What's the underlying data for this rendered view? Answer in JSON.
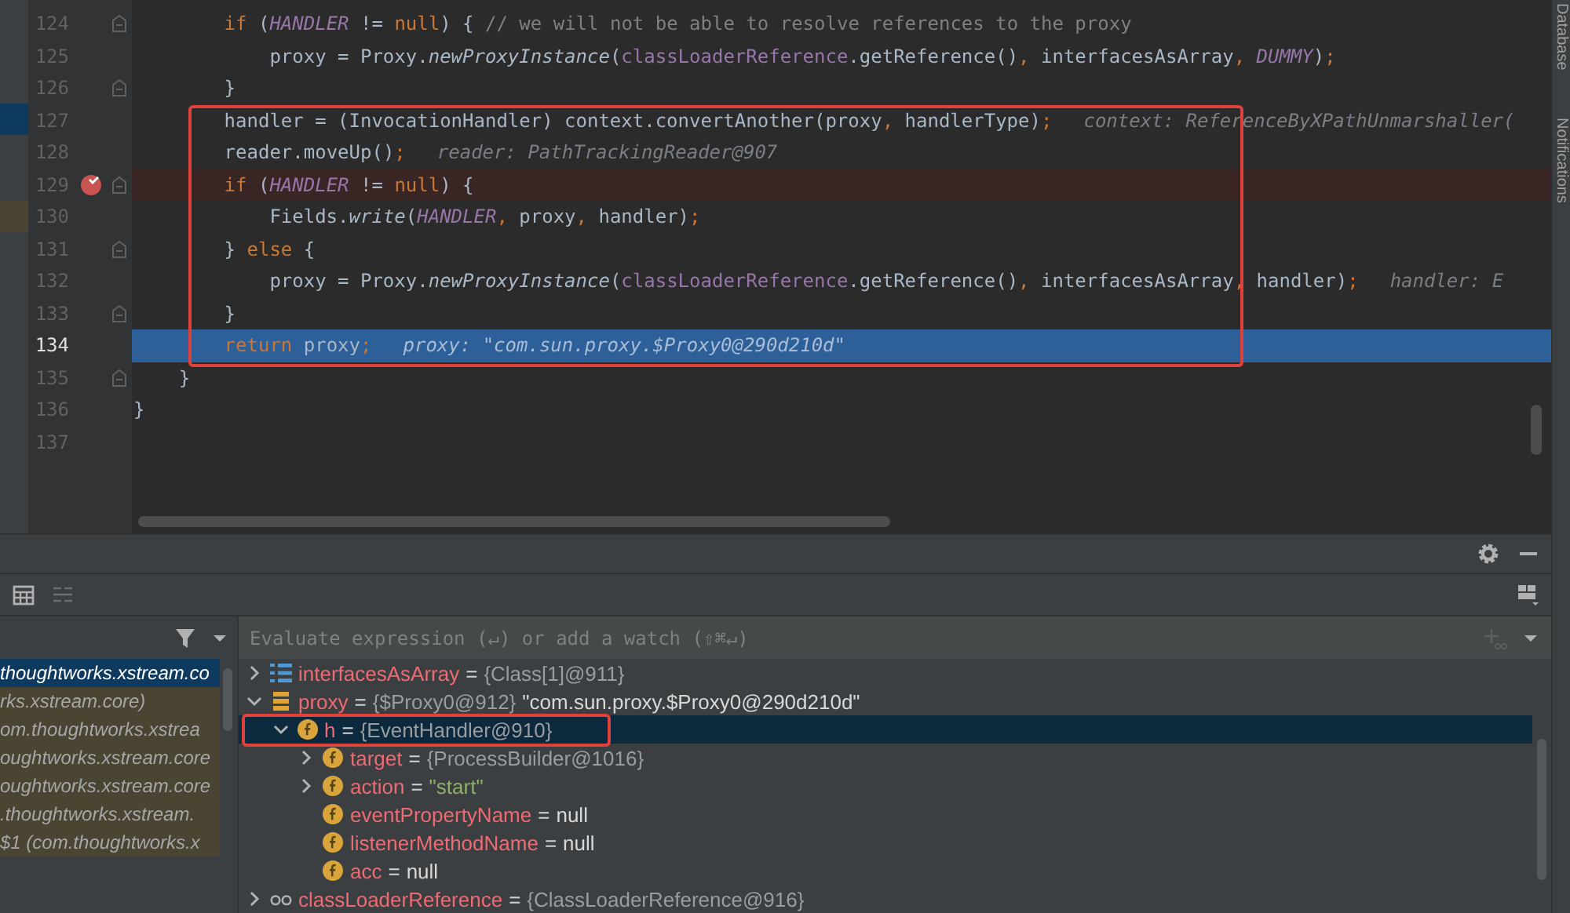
{
  "editor": {
    "lines": [
      {
        "number": "124",
        "fold": true,
        "breakpoint": false,
        "current": false,
        "boxed": false,
        "tokens": [
          {
            "kind": "kw",
            "text": "if"
          },
          {
            "kind": "plain",
            "text": " ("
          },
          {
            "kind": "static",
            "text": "HANDLER"
          },
          {
            "kind": "plain",
            "text": " != "
          },
          {
            "kind": "kw",
            "text": "null"
          },
          {
            "kind": "plain",
            "text": ") { "
          },
          {
            "kind": "comment",
            "text": "// we will not be able to resolve references to the proxy"
          }
        ]
      },
      {
        "number": "125",
        "fold": false,
        "breakpoint": false,
        "current": false,
        "boxed": false,
        "tokens": [
          {
            "kind": "plain",
            "text": "proxy = Proxy."
          },
          {
            "kind": "method",
            "text": "newProxyInstance"
          },
          {
            "kind": "plain",
            "text": "("
          },
          {
            "kind": "field",
            "text": "classLoaderReference"
          },
          {
            "kind": "plain",
            "text": ".getReference()"
          },
          {
            "kind": "punct",
            "text": ", "
          },
          {
            "kind": "plain",
            "text": "interfacesAsArray"
          },
          {
            "kind": "punct",
            "text": ", "
          },
          {
            "kind": "static",
            "text": "DUMMY"
          },
          {
            "kind": "plain",
            "text": ")"
          },
          {
            "kind": "punct",
            "text": ";"
          }
        ]
      },
      {
        "number": "126",
        "fold": true,
        "breakpoint": false,
        "current": false,
        "boxed": false,
        "tokens": [
          {
            "kind": "plain",
            "text": "}"
          }
        ]
      },
      {
        "number": "127",
        "fold": false,
        "breakpoint": false,
        "current": false,
        "boxed": true,
        "tokens": [
          {
            "kind": "plain",
            "text": "handler = (InvocationHandler) context.convertAnother(proxy"
          },
          {
            "kind": "punct",
            "text": ", "
          },
          {
            "kind": "plain",
            "text": "handlerType)"
          },
          {
            "kind": "punct",
            "text": ";"
          }
        ],
        "hint": "context: ReferenceByXPathUnmarshaller("
      },
      {
        "number": "128",
        "fold": false,
        "breakpoint": false,
        "current": false,
        "boxed": true,
        "tokens": [
          {
            "kind": "plain",
            "text": "reader.moveUp()"
          },
          {
            "kind": "punct",
            "text": ";"
          }
        ],
        "hint": "reader: PathTrackingReader@907"
      },
      {
        "number": "129",
        "fold": true,
        "breakpoint": true,
        "current": false,
        "boxed": true,
        "tokens": [
          {
            "kind": "kw",
            "text": "if"
          },
          {
            "kind": "plain",
            "text": " ("
          },
          {
            "kind": "static",
            "text": "HANDLER"
          },
          {
            "kind": "plain",
            "text": " != "
          },
          {
            "kind": "kw",
            "text": "null"
          },
          {
            "kind": "plain",
            "text": ") {"
          }
        ]
      },
      {
        "number": "130",
        "fold": false,
        "breakpoint": false,
        "current": false,
        "boxed": true,
        "tokens": [
          {
            "kind": "plain",
            "text": "Fields."
          },
          {
            "kind": "method",
            "text": "write"
          },
          {
            "kind": "plain",
            "text": "("
          },
          {
            "kind": "static",
            "text": "HANDLER"
          },
          {
            "kind": "punct",
            "text": ", "
          },
          {
            "kind": "plain",
            "text": "proxy"
          },
          {
            "kind": "punct",
            "text": ", "
          },
          {
            "kind": "plain",
            "text": "handler)"
          },
          {
            "kind": "punct",
            "text": ";"
          }
        ]
      },
      {
        "number": "131",
        "fold": true,
        "breakpoint": false,
        "current": false,
        "boxed": true,
        "tokens": [
          {
            "kind": "plain",
            "text": "} "
          },
          {
            "kind": "kw",
            "text": "else"
          },
          {
            "kind": "plain",
            "text": " {"
          }
        ]
      },
      {
        "number": "132",
        "fold": false,
        "breakpoint": false,
        "current": false,
        "boxed": true,
        "tokens": [
          {
            "kind": "plain",
            "text": "proxy = Proxy."
          },
          {
            "kind": "method",
            "text": "newProxyInstance"
          },
          {
            "kind": "plain",
            "text": "("
          },
          {
            "kind": "field",
            "text": "classLoaderReference"
          },
          {
            "kind": "plain",
            "text": ".getReference()"
          },
          {
            "kind": "punct",
            "text": ", "
          },
          {
            "kind": "plain",
            "text": "interfacesAsArray"
          },
          {
            "kind": "punct",
            "text": ", "
          },
          {
            "kind": "plain",
            "text": "handler)"
          },
          {
            "kind": "punct",
            "text": ";"
          }
        ],
        "hint": "handler: E"
      },
      {
        "number": "133",
        "fold": true,
        "breakpoint": false,
        "current": false,
        "boxed": true,
        "tokens": [
          {
            "kind": "plain",
            "text": "}"
          }
        ]
      },
      {
        "number": "134",
        "fold": false,
        "breakpoint": false,
        "current": true,
        "boxed": true,
        "tokens": [
          {
            "kind": "kw",
            "text": "return"
          },
          {
            "kind": "plain",
            "text": " proxy"
          },
          {
            "kind": "punct",
            "text": ";"
          }
        ],
        "hint": "proxy: \"com.sun.proxy.$Proxy0@290d210d\""
      },
      {
        "number": "135",
        "fold": true,
        "breakpoint": false,
        "current": false,
        "boxed": false,
        "tokens": [
          {
            "kind": "plain",
            "text": "}"
          }
        ]
      },
      {
        "number": "136",
        "fold": false,
        "breakpoint": false,
        "current": false,
        "boxed": false,
        "tokens": [
          {
            "kind": "plain",
            "text": "}"
          }
        ]
      },
      {
        "number": "137",
        "fold": false,
        "breakpoint": false,
        "current": false,
        "boxed": false
      }
    ]
  },
  "right_toolbar": {
    "tabs": [
      {
        "label": "Database"
      },
      {
        "label": "Notifications"
      }
    ]
  },
  "debugger": {
    "frames": [
      {
        "label": "thoughtworks.xstream.co",
        "selected": true
      },
      {
        "label": "rks.xstream.core)",
        "selected": false
      },
      {
        "label": "om.thoughtworks.xstrea",
        "selected": false
      },
      {
        "label": "oughtworks.xstream.core",
        "selected": false
      },
      {
        "label": "oughtworks.xstream.core",
        "selected": false
      },
      {
        "label": ".thoughtworks.xstream.",
        "selected": false
      },
      {
        "label": "$1 (com.thoughtworks.x",
        "selected": false
      }
    ],
    "evaluate_field": {
      "placeholder": "Evaluate expression (↵) or add a watch (⇧⌘↵)"
    },
    "variables": [
      {
        "kind": "array",
        "name": "interfacesAsArray",
        "value": [
          {
            "kind": "op",
            "text": "="
          },
          {
            "kind": "ref",
            "text": "{Class[1]@911}"
          }
        ],
        "expanded": false,
        "selected": false,
        "boxed": false
      },
      {
        "kind": "object",
        "name": "proxy",
        "value": [
          {
            "kind": "op",
            "text": "="
          },
          {
            "kind": "ref",
            "text": "{$Proxy0@912}"
          },
          {
            "kind": "tostring",
            "text": "\"com.sun.proxy.$Proxy0@290d210d\""
          }
        ],
        "expanded": true,
        "selected": false,
        "boxed": false,
        "children": [
          {
            "kind": "field",
            "name": "h",
            "value": [
              {
                "kind": "op",
                "text": "="
              },
              {
                "kind": "ref",
                "text": "{EventHandler@910}"
              }
            ],
            "expanded": true,
            "selected": true,
            "boxed": true,
            "children": [
              {
                "kind": "field",
                "name": "target",
                "value": [
                  {
                    "kind": "op",
                    "text": "="
                  },
                  {
                    "kind": "ref",
                    "text": "{ProcessBuilder@1016}"
                  }
                ],
                "expanded": false,
                "selected": false,
                "boxed": false
              },
              {
                "kind": "field",
                "name": "action",
                "value": [
                  {
                    "kind": "op",
                    "text": "="
                  },
                  {
                    "kind": "string",
                    "text": "\"start\""
                  }
                ],
                "expanded": false,
                "selected": false,
                "boxed": false
              },
              {
                "kind": "field",
                "name": "eventPropertyName",
                "value": [
                  {
                    "kind": "op",
                    "text": "="
                  },
                  {
                    "kind": "null",
                    "text": "null"
                  }
                ],
                "selected": false,
                "boxed": false
              },
              {
                "kind": "field",
                "name": "listenerMethodName",
                "value": [
                  {
                    "kind": "op",
                    "text": "="
                  },
                  {
                    "kind": "null",
                    "text": "null"
                  }
                ],
                "selected": false,
                "boxed": false
              },
              {
                "kind": "field",
                "name": "acc",
                "value": [
                  {
                    "kind": "op",
                    "text": "="
                  },
                  {
                    "kind": "null",
                    "text": "null"
                  }
                ],
                "selected": false,
                "boxed": false
              }
            ]
          }
        ]
      },
      {
        "kind": "watch",
        "name": "classLoaderReference",
        "value": [
          {
            "kind": "op",
            "text": "="
          },
          {
            "kind": "ref",
            "text": "{ClassLoaderReference@916}"
          }
        ],
        "expanded": false,
        "selected": false,
        "boxed": false
      }
    ]
  }
}
